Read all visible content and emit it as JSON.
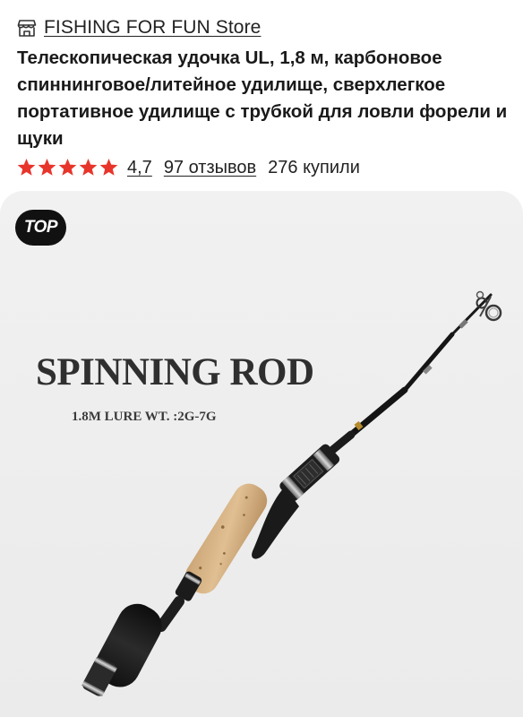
{
  "store": {
    "icon": "storefront-icon",
    "name": "FISHING FOR FUN Store"
  },
  "product": {
    "title": "Телескопическая удочка UL, 1,8 м, карбоновое спиннинговое/литейное удилище, сверхлегкое портативное удилище с трубкой для ловли форели и щуки",
    "rating": {
      "stars": 5,
      "value": "4,7",
      "reviews": "97 отзывов",
      "bought": "276 купили",
      "star_color": "#e8352b"
    }
  },
  "image": {
    "badge": "TOP",
    "heading": "SPINNING ROD",
    "spec": "1.8M  LURE WT. :2G-7G"
  }
}
